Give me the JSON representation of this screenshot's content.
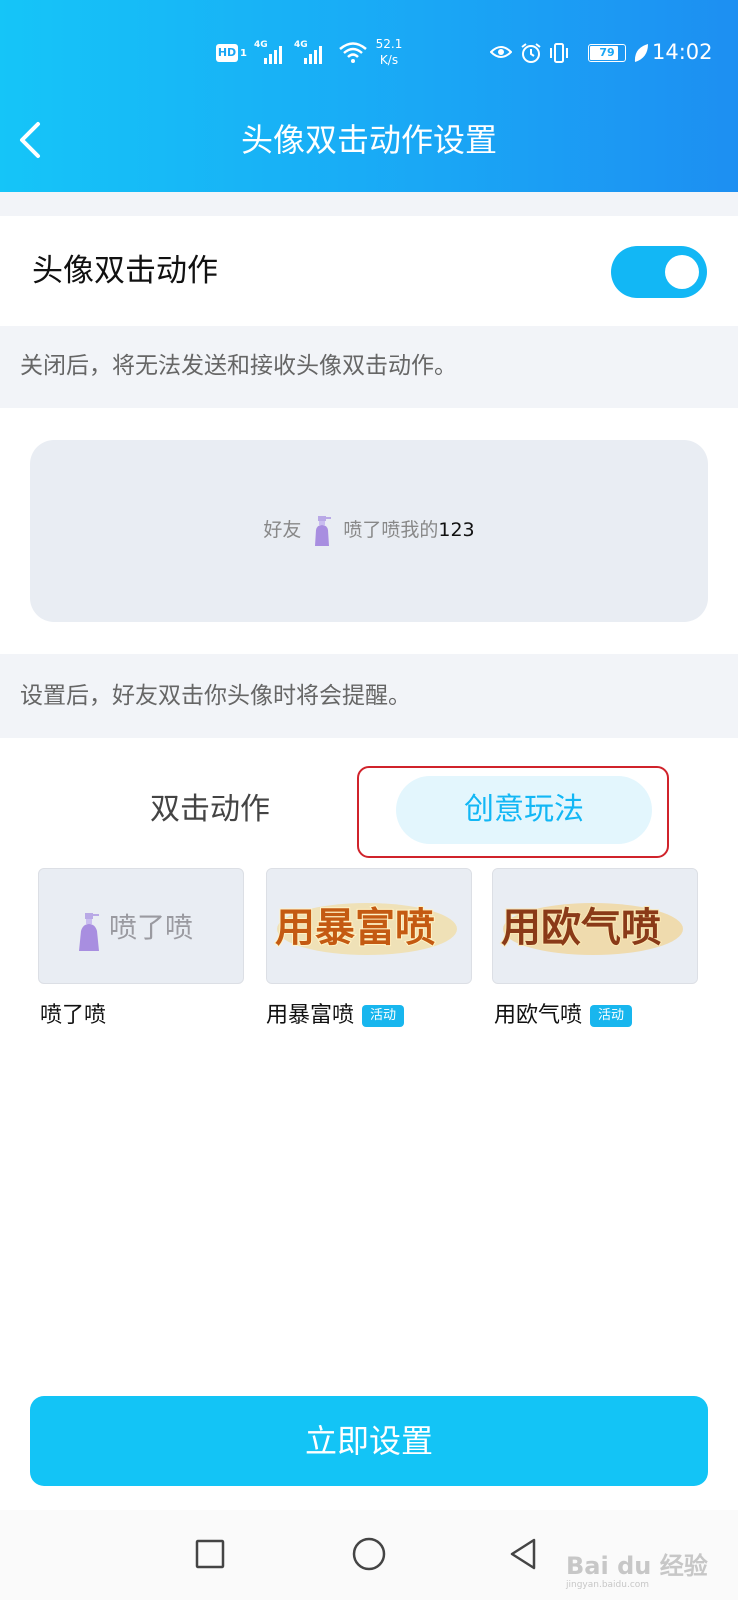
{
  "status_bar": {
    "hd_label": "HD",
    "hd_sub": "1",
    "signal_1": "4G",
    "signal_2": "4G",
    "speed_value": "52.1",
    "speed_unit": "K/s",
    "battery": "79",
    "time": "14:02"
  },
  "header": {
    "title": "头像双击动作设置"
  },
  "toggle": {
    "label": "头像双击动作",
    "enabled": true
  },
  "hints": {
    "toggle_hint": "关闭后，将无法发送和接收头像双击动作。",
    "preview_hint": "设置后，好友双击你头像时将会提醒。"
  },
  "preview": {
    "prefix": "好友",
    "action": "喷了喷我的",
    "target": "123"
  },
  "tabs": [
    {
      "label": "双击动作",
      "active": false
    },
    {
      "label": "创意玩法",
      "active": true
    }
  ],
  "items": [
    {
      "name": "喷了喷",
      "thumb_text": "喷了喷",
      "badge": ""
    },
    {
      "name": "用暴富喷",
      "thumb_text": "用暴富喷",
      "badge": "活动"
    },
    {
      "name": "用欧气喷",
      "thumb_text": "用欧气喷",
      "badge": "活动"
    }
  ],
  "primary_button": "立即设置",
  "watermark": {
    "main": "Bai du 经验",
    "sub": "jingyan.baidu.com"
  },
  "colors": {
    "header_start": "#15c5f8",
    "header_end": "#1d8ff2",
    "accent": "#12b7f5",
    "badge": "#18b6ee",
    "highlight": "#d0232b"
  }
}
